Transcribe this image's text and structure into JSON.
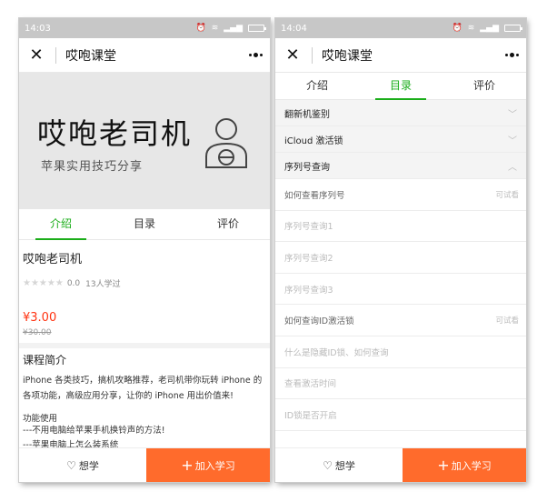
{
  "left": {
    "time": "14:03",
    "nav_close": "✕",
    "nav_title": "哎咆课堂",
    "banner": {
      "title": "哎咆老司机",
      "subtitle": "苹果实用技巧分享"
    },
    "tabs": [
      {
        "label": "介绍",
        "active": true
      },
      {
        "label": "目录",
        "active": false
      },
      {
        "label": "评价",
        "active": false
      }
    ],
    "course": {
      "name": "哎咆老司机",
      "stars": "★★★★★",
      "score": "0.0",
      "learners": "13人学过",
      "price": "¥3.00",
      "old_price": "¥30.00",
      "intro_title": "课程简介",
      "intro_text": "iPhone 各类技巧，搞机攻略推荐，老司机带你玩转 iPhone 的各项功能，高级应用分享，让你的 iPhone 用出价值来!",
      "feature_title": "功能使用",
      "feature_items": [
        "---不用电脑给苹果手机换铃声的方法!",
        "---苹果电脑上怎么装系统"
      ]
    },
    "bottom": {
      "want_label": "想学",
      "join_label": "加入学习"
    }
  },
  "right": {
    "time": "14:04",
    "nav_close": "✕",
    "nav_title": "哎咆课堂",
    "tabs": [
      {
        "label": "介绍",
        "active": false
      },
      {
        "label": "目录",
        "active": true
      },
      {
        "label": "评价",
        "active": false
      }
    ],
    "sections": [
      {
        "title": "翻新机鉴别",
        "expanded": false
      },
      {
        "title": "iCloud 激活锁",
        "expanded": false
      },
      {
        "title": "序列号查询",
        "expanded": true
      }
    ],
    "lessons": [
      {
        "title": "如何查看序列号",
        "tag": "可试看"
      },
      {
        "title": "序列号查询1",
        "tag": ""
      },
      {
        "title": "序列号查询2",
        "tag": ""
      },
      {
        "title": "序列号查询3",
        "tag": ""
      },
      {
        "title": "如何查询ID激活锁",
        "tag": "可试看"
      },
      {
        "title": "什么是隐藏ID锁、如何查询",
        "tag": ""
      },
      {
        "title": "查看激活时间",
        "tag": ""
      },
      {
        "title": "ID锁是否开启",
        "tag": ""
      }
    ],
    "bottom": {
      "want_label": "想学",
      "join_label": "加入学习"
    }
  },
  "colors": {
    "accent_green": "#1aad19",
    "price_red": "#ff3311",
    "join_orange": "#ff6b2c"
  }
}
